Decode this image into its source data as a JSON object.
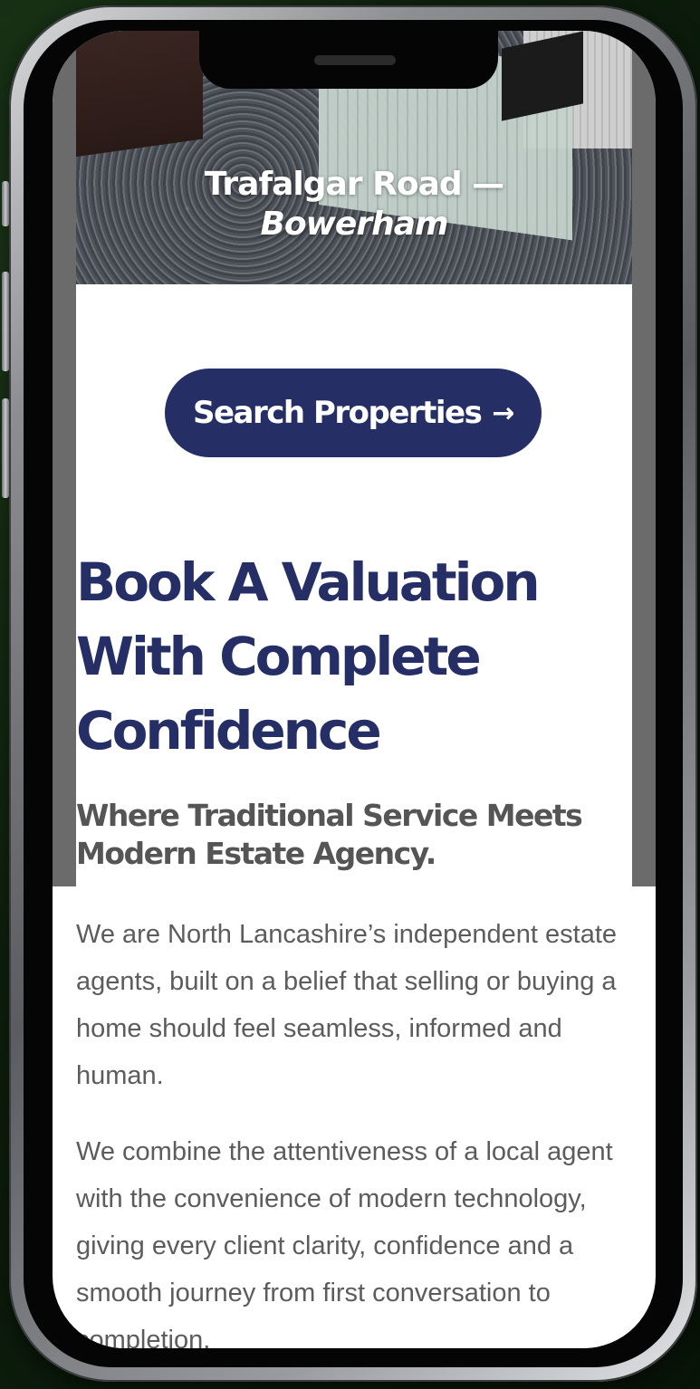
{
  "hero": {
    "road": "Trafalgar Road —",
    "area": "Bowerham"
  },
  "cta": {
    "label": "Search Properties",
    "arrow": "→"
  },
  "main": {
    "heading": "Book A Valuation With Complete Confidence",
    "subheading": "Where Traditional Service Meets Modern Estate Agency.",
    "paragraph_1": "We are North Lancashire’s independent estate agents, built on a belief that selling or buying a home should feel seamless, informed and human.",
    "paragraph_2": "We combine the attentiveness of a local agent with the convenience of modern technology, giving every client clarity, confidence and a smooth journey from first conversation to completion."
  },
  "colors": {
    "brand_navy": "#252f66",
    "subheading_gray": "#555555",
    "body_text": "#5c5c5c"
  },
  "icons": {
    "cta_arrow": "arrow-right-icon"
  }
}
